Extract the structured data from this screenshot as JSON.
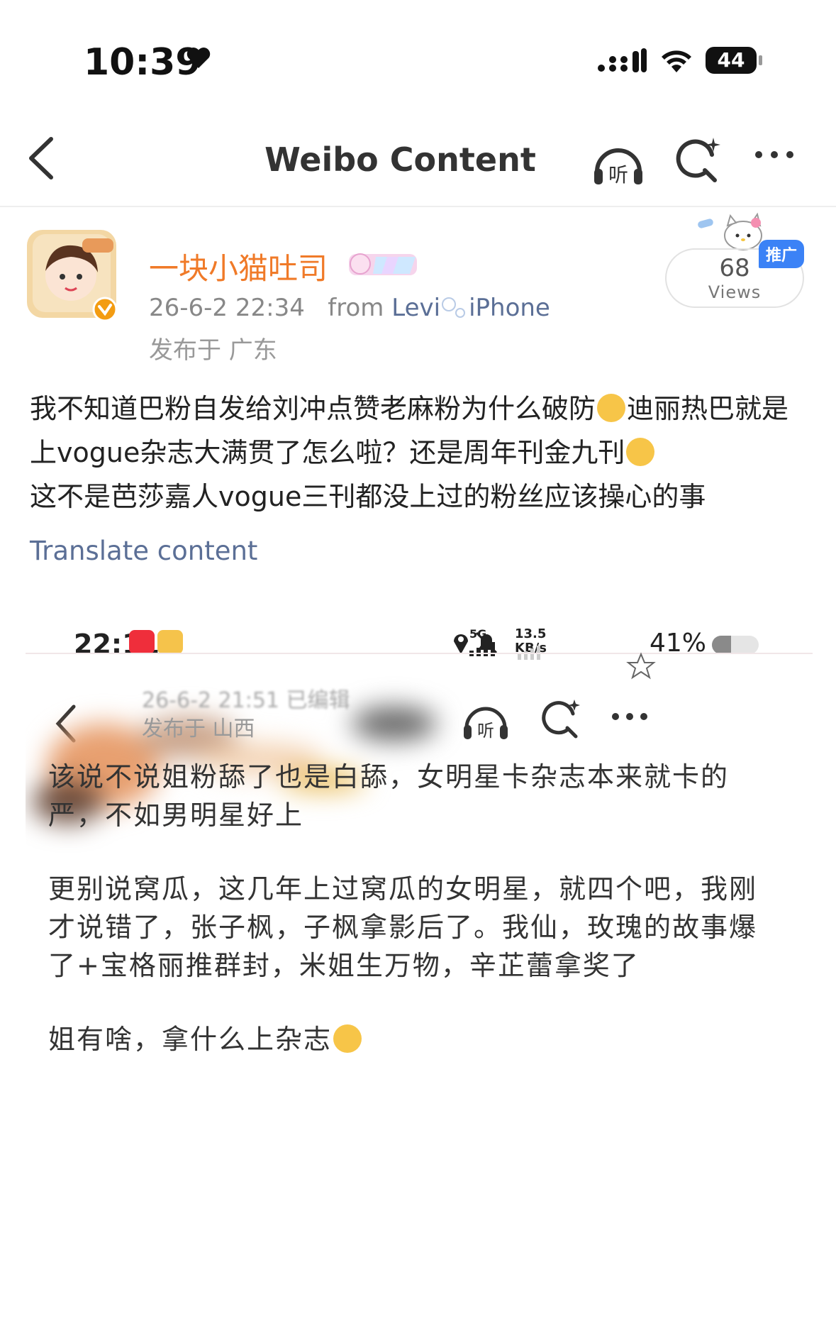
{
  "status_bar": {
    "time": "10:39",
    "battery": "44"
  },
  "nav": {
    "title": "Weibo Content",
    "icons": [
      "back-icon",
      "listen-icon",
      "search-icon",
      "more-icon"
    ],
    "listen_label": "听"
  },
  "post": {
    "author": "一块小猫吐司",
    "timestamp": "26-6-2 22:34",
    "source_prefix": "from",
    "source_name": "Levi",
    "source_device": "iPhone",
    "location": "发布于 广东",
    "views_count": "68",
    "views_label": "Views",
    "promo_tag": "推广",
    "text_lines": [
      "我不知道巴粉自发给刘冲点赞老麻粉为什么破防",
      "迪丽热巴就是上vogue杂志大满贯了怎么啦？还是周年刊金九刊",
      "这不是芭莎嘉人vogue三刊都没上过的粉丝应该操心的事"
    ],
    "translate_label": "Translate content"
  },
  "embedded_screenshot": {
    "time": "22:11",
    "network_speed_top": "13.5",
    "network_speed_unit": "KB/s",
    "network_type": "5G",
    "battery_pct": "41%",
    "battery_level": 0.41,
    "listen_label": "听",
    "meta_blurred": "26-6-2 21:51  已编辑",
    "location": "发布于 山西",
    "paragraphs": [
      "该说不说姐粉舔了也是白舔，女明星卡杂志本来就卡的严，不如男明星好上",
      "更别说窝瓜，这几年上过窝瓜的女明星，就四个吧，我刚才说错了，张子枫，子枫拿影后了。我仙，玫瑰的故事爆了+宝格丽推群封，米姐生万物，辛芷蕾拿奖了",
      "姐有啥，拿什么上杂志"
    ]
  },
  "colors": {
    "author": "#f07a28",
    "link": "#5b6f96",
    "promo": "#3b82f6"
  }
}
